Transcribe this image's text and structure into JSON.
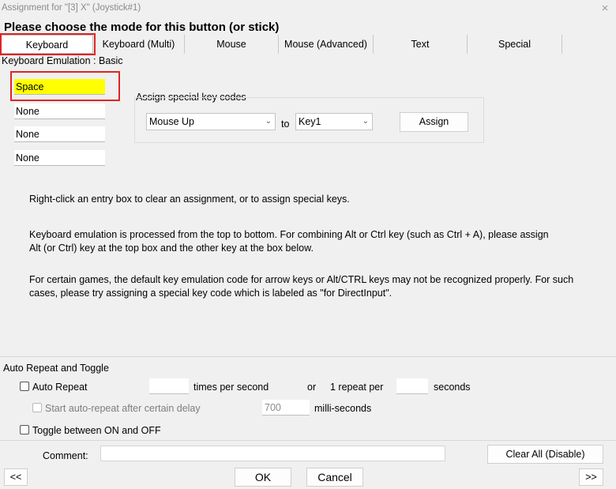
{
  "window": {
    "title": "Assignment for \"[3] X\" (Joystick#1)",
    "close_glyph": "×"
  },
  "heading": "Please choose the mode for this button (or stick)",
  "tabs": [
    {
      "label": "Keyboard",
      "active": true
    },
    {
      "label": "Keyboard (Multi)"
    },
    {
      "label": "Mouse"
    },
    {
      "label": "Mouse (Advanced)"
    },
    {
      "label": "Text"
    },
    {
      "label": "Special"
    }
  ],
  "emulation_label": "Keyboard Emulation : Basic",
  "key_entries": [
    "Space",
    "None",
    "None",
    "None"
  ],
  "special_keys": {
    "group_label": "Assign special key codes",
    "from_value": "Mouse Up",
    "to_label": "to",
    "to_value": "Key1",
    "assign_button": "Assign"
  },
  "help": {
    "p1": [
      "Right-click an entry box to clear an assignment, or to assign special keys."
    ],
    "p2": [
      "Keyboard emulation is processed from the top to bottom.  For combining Alt or Ctrl key (such as Ctrl + A), please assign",
      "Alt (or Ctrl) key at the top box and the other key at the box below."
    ],
    "p3": [
      "For certain games, the default key emulation code for arrow keys or Alt/CTRL keys may not be recognized properly.  For such",
      "cases, please try assigning a special key code which is labeled as \"for DirectInput\"."
    ]
  },
  "auto_repeat": {
    "section_label": "Auto Repeat and Toggle",
    "auto_repeat_label": "Auto Repeat",
    "auto_repeat_checked": false,
    "times_value": "",
    "times_label": "times per second",
    "or_label": "or",
    "repeat_per_label": "1 repeat per",
    "seconds_value": "",
    "seconds_label": "seconds",
    "delay_label": "Start auto-repeat after certain delay",
    "delay_checked": false,
    "delay_value": "700",
    "delay_unit": "milli-seconds",
    "toggle_label": "Toggle between ON and OFF",
    "toggle_checked": false
  },
  "footer": {
    "comment_label": "Comment:",
    "comment_value": "",
    "clear_all_button": "Clear All (Disable)",
    "prev_button": "<<",
    "ok_button": "OK",
    "cancel_button": "Cancel",
    "next_button": ">>"
  }
}
